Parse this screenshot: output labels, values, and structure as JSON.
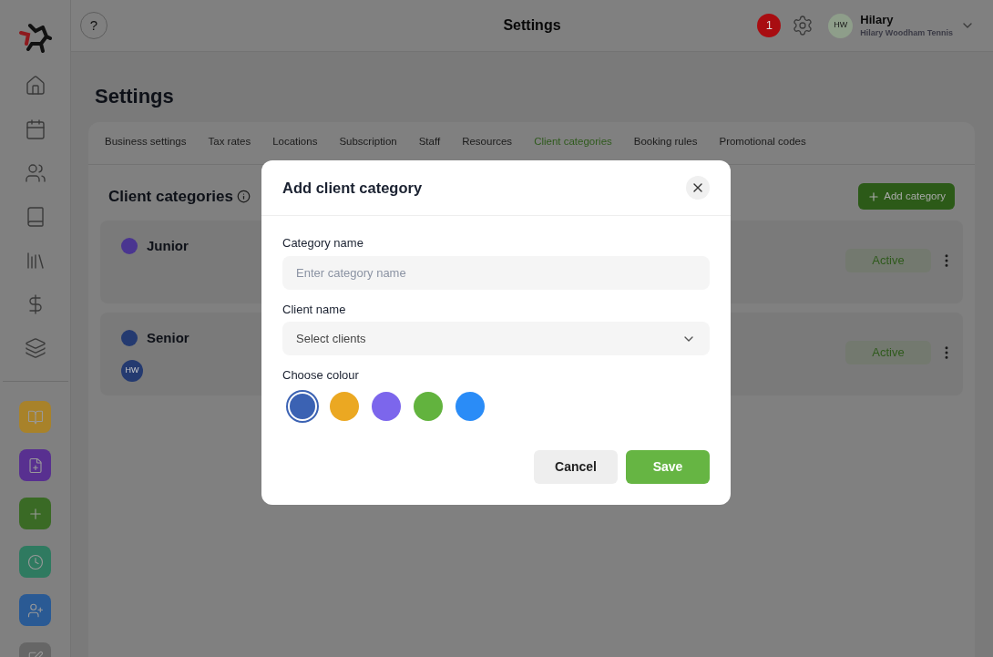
{
  "header": {
    "help": "?",
    "title": "Settings",
    "notifications": "1",
    "user": {
      "initials": "HW",
      "name": "Hilary",
      "business": "Hilary Woodham Tennis"
    }
  },
  "sidebar": {
    "quick": [
      {
        "color": "#a8822a"
      },
      {
        "color": "#583090"
      },
      {
        "color": "#3a6a25"
      },
      {
        "color": "#2f7a60"
      },
      {
        "color": "#2a5a94"
      },
      {
        "color": "#666666"
      }
    ]
  },
  "page_title": "Settings",
  "tabs": [
    {
      "label": "Business settings",
      "selected": false
    },
    {
      "label": "Tax rates",
      "selected": false
    },
    {
      "label": "Locations",
      "selected": false
    },
    {
      "label": "Subscription",
      "selected": false
    },
    {
      "label": "Staff",
      "selected": false
    },
    {
      "label": "Resources",
      "selected": false
    },
    {
      "label": "Client categories",
      "selected": true
    },
    {
      "label": "Booking rules",
      "selected": false
    },
    {
      "label": "Promotional codes",
      "selected": false
    }
  ],
  "section": {
    "title": "Client categories",
    "add_button": "Add category"
  },
  "categories": [
    {
      "name": "Junior",
      "color": "#4a3590",
      "status": "Active"
    },
    {
      "name": "Senior",
      "color": "#243a70",
      "clients": [
        "HW"
      ],
      "status": "Active"
    }
  ],
  "modal": {
    "title": "Add client category",
    "fields": [
      {
        "label": "Category name",
        "kind": "text",
        "placeholder": "Enter category name"
      },
      {
        "label": "Client name",
        "kind": "select",
        "value": "Select clients"
      }
    ],
    "colour_label": "Choose colour",
    "colours": [
      {
        "color": "#3b62b3",
        "selected": true
      },
      {
        "color": "#eba822",
        "selected": false
      },
      {
        "color": "#7c66ec",
        "selected": false
      },
      {
        "color": "#62b33e",
        "selected": false
      },
      {
        "color": "#2a8cf7",
        "selected": false
      }
    ],
    "buttons": [
      {
        "label": "Cancel",
        "kind": "secondary"
      },
      {
        "label": "Save",
        "kind": "primary"
      }
    ]
  }
}
